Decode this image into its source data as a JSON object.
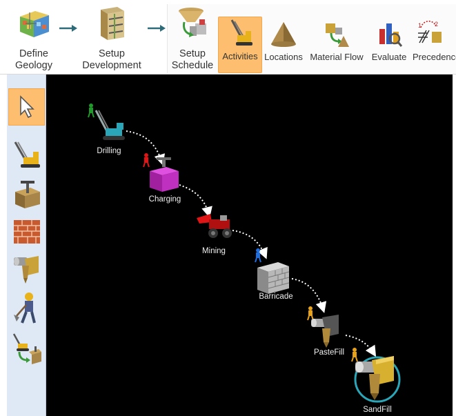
{
  "ribbon": {
    "define_geology": "Define\nGeology",
    "setup_development": "Setup\nDevelopment",
    "setup_schedule": "Setup\nSchedule",
    "activities": "Activities",
    "locations": "Locations",
    "material_flow": "Material Flow",
    "evaluate": "Evaluate",
    "precedence": "Precedence",
    "active_tab": "Activities"
  },
  "left_toolbar": {
    "tools": [
      "pointer-tool",
      "drill-rig-tool",
      "charging-tool",
      "brick-wall-tool",
      "fill-pipe-tool",
      "worker-tool",
      "sequence-tool"
    ],
    "selected": "pointer-tool"
  },
  "activities": [
    {
      "name": "Drilling",
      "person_color": "#1f9a2a"
    },
    {
      "name": "Charging",
      "person_color": "#e01515"
    },
    {
      "name": "Mining",
      "person_color": "#e01515"
    },
    {
      "name": "Barricade",
      "person_color": "#1e6ee0"
    },
    {
      "name": "PasteFill",
      "person_color": "#e8a21a"
    },
    {
      "name": "SandFill",
      "person_color": "#e8a21a"
    }
  ],
  "colors": {
    "ribbon_active": "#fdbf6f",
    "toolbar_bg": "#dfe9f5",
    "canvas_bg": "#000000",
    "connector": "#ffffff",
    "arrow_teal": "#2d6b78"
  }
}
